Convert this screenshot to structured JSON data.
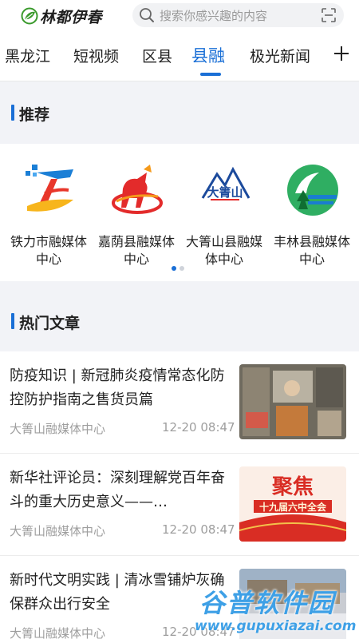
{
  "header": {
    "app_name": "林都伊春",
    "search_placeholder": "搜索你感兴趣的内容"
  },
  "tabs": [
    {
      "label": "黑龙江",
      "active": false
    },
    {
      "label": "短视频",
      "active": false
    },
    {
      "label": "区县",
      "active": false
    },
    {
      "label": "县融",
      "active": true
    },
    {
      "label": "极光新闻",
      "active": false
    }
  ],
  "recommend": {
    "title": "推荐",
    "items": [
      {
        "name": "铁力市融媒体中心"
      },
      {
        "name": "嘉荫县融媒体中心"
      },
      {
        "name": "大箐山县融媒体中心"
      },
      {
        "name": "丰林县融媒体中心"
      }
    ],
    "logo_text_3": "大箐山",
    "pages": 2,
    "current_page": 1
  },
  "hot": {
    "title": "热门文章",
    "articles": [
      {
        "title": "防疫知识 | 新冠肺炎疫情常态化防控防护指南之售货员篇",
        "source": "大箐山融媒体中心",
        "time": "12-20 08:47"
      },
      {
        "title": "新华社评论员：深刻理解党百年奋斗的重大历史意义——…",
        "source": "大箐山融媒体中心",
        "time": "12-20 08:47",
        "thumb_text_1": "聚焦",
        "thumb_text_2": "十九届六中全会"
      },
      {
        "title": "新时代文明实践 | 清冰雪铺炉灰确保群众出行安全",
        "source": "大箐山融媒体中心",
        "time": "12-20 08:47"
      }
    ]
  },
  "watermark": {
    "title": "谷普软件园",
    "url": "www.gupuxiazai.com"
  },
  "colors": {
    "accent": "#1a6fd6",
    "background": "#f2f3f7",
    "muted_text": "#9e9e9e"
  }
}
